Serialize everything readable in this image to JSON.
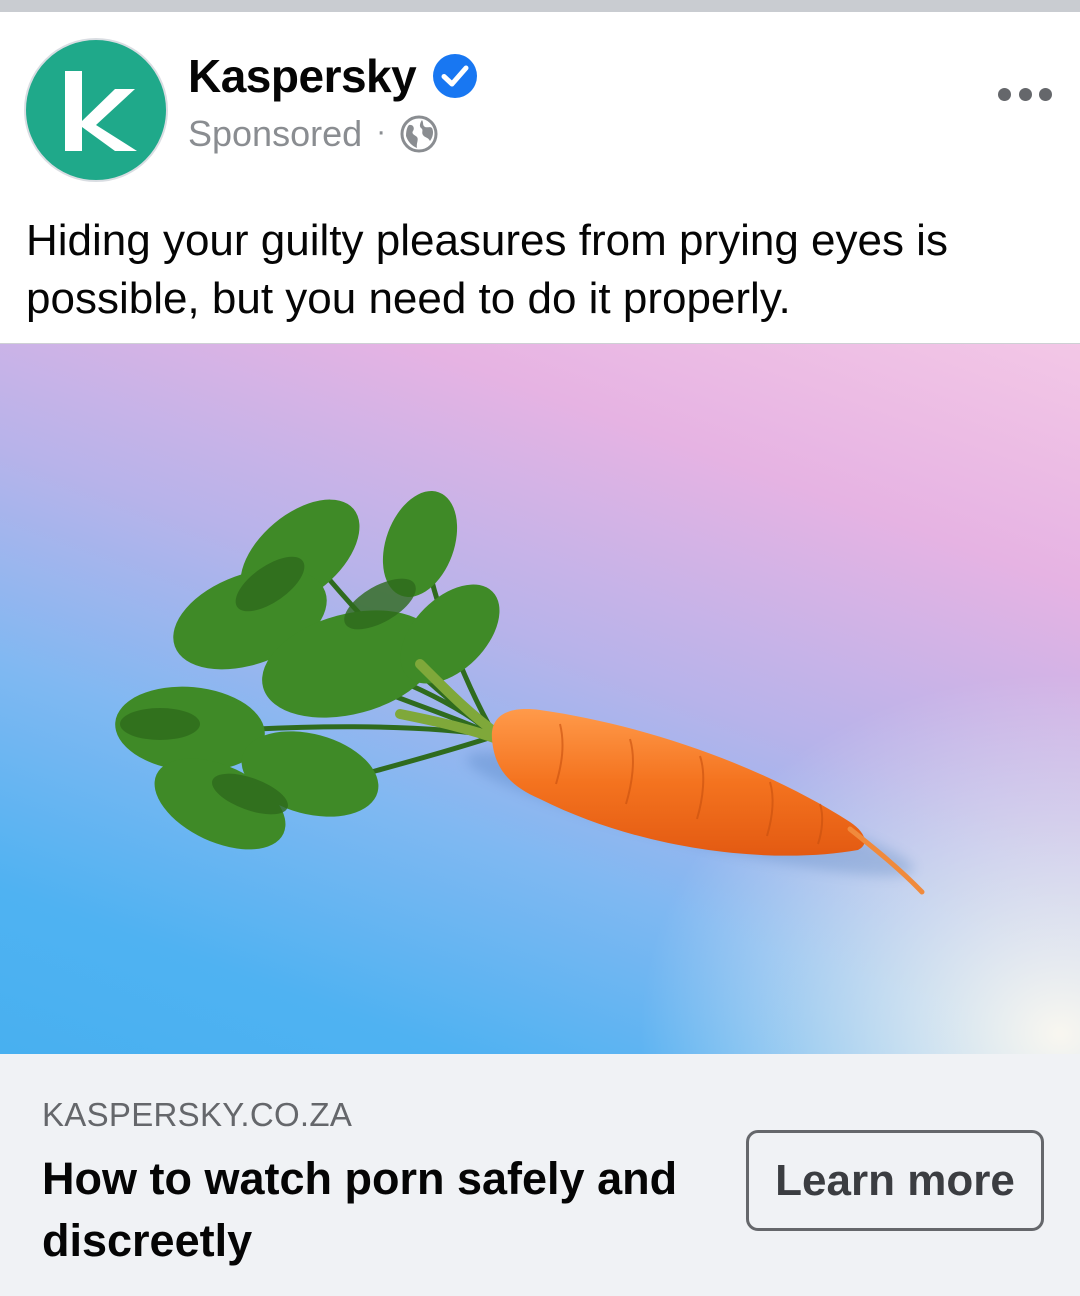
{
  "post": {
    "advertiser": "Kaspersky",
    "sponsored_label": "Sponsored",
    "separator": "·",
    "logo_letter": "k",
    "caption": "Hiding your guilty pleasures from prying eyes is possible, but you need to do it properly.",
    "icons": {
      "verified": "verified-badge-icon",
      "audience": "globe-icon",
      "more": "more-options-icon"
    },
    "media": {
      "subject": "carrot-illustration"
    },
    "link": {
      "domain": "KASPERSKY.CO.ZA",
      "headline": "How to watch porn safely and discreetly",
      "cta_label": "Learn more"
    }
  },
  "colors": {
    "brand_green": "#1fa98a",
    "verified_blue": "#1877f2",
    "link_bar_bg": "#f0f2f5",
    "secondary_text": "#65676b"
  }
}
